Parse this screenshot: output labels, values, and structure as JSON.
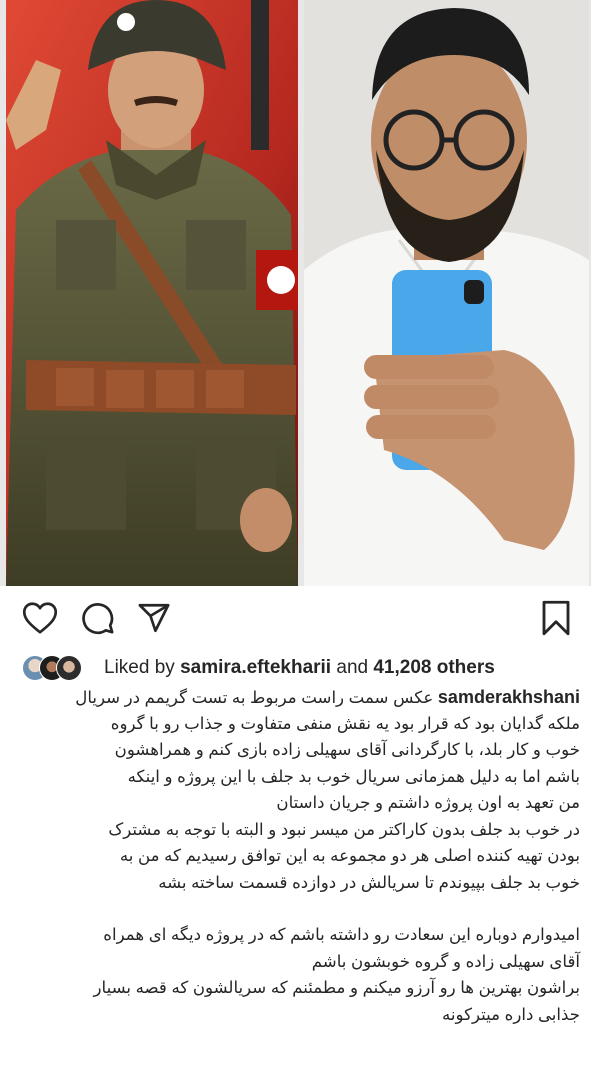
{
  "post": {
    "likes": {
      "prefix": "Liked by",
      "user": "samira.eftekharii",
      "joiner": "and",
      "count": "41,208 others"
    },
    "caption": {
      "username": "samderakhshani",
      "first_line": "عکس سمت راست مربوط به تست گریمم در سریال",
      "lines": [
        "ملکه گدایان بود که قرار بود یه نقش منفی متفاوت و جذاب رو با گروه",
        "خوب و کار بلد، با کارگردانی آقای سهیلی زاده بازی کنم  و همراهشون",
        "باشم اما به دلیل همزمانی سریال خوب بد جلف با این پروژه و اینکه",
        "من تعهد به اون پروژه داشتم و جریان داستان",
        "در خوب بد جلف بدون کاراکتر من میسر نبود و البته با توجه به مشترک",
        "بودن تهیه کننده اصلی هر دو مجموعه  به این توافق رسیدیم که من به",
        "خوب بد جلف بپیوندم تا سریالش در دوازده قسمت ساخته بشه"
      ],
      "lines2": [
        "امیدوارم دوباره این سعادت رو داشته باشم که در  پروژه دیگه ای همراه",
        "آقای سهیلی زاده و گروه خوبشون باشم",
        "براشون بهترین ها رو آرزو میکنم و مطمئنم که سریالشون که قصه بسیار",
        "جذابی داره میترکونه"
      ]
    }
  },
  "icons": {
    "like": "heart-icon",
    "comment": "comment-icon",
    "share": "paper-plane-icon",
    "save": "bookmark-icon"
  },
  "colors": {
    "text": "#262626",
    "background": "#ffffff"
  }
}
